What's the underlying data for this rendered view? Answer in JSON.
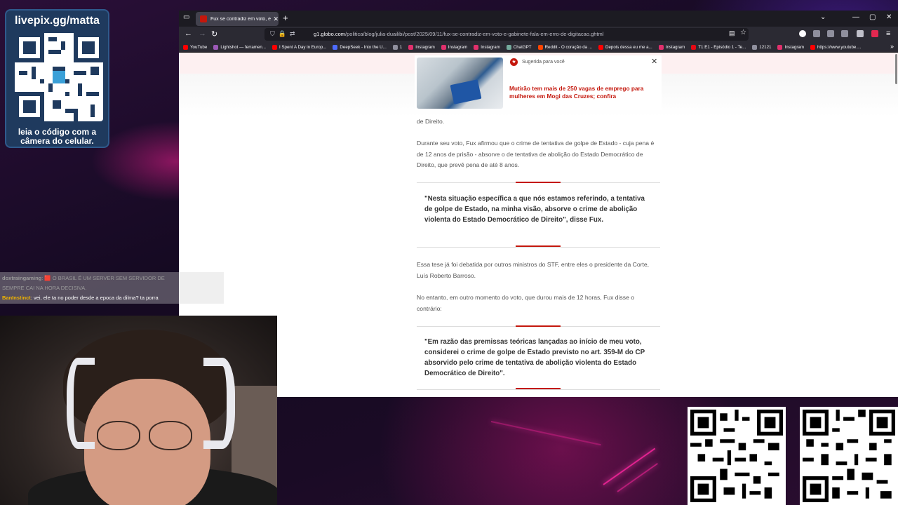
{
  "qr_widget": {
    "title": "livepix.gg/matta",
    "caption_line1": "leia o código com a",
    "caption_line2": "câmera do celular."
  },
  "browser": {
    "tab_title": "Fux se contradiz em voto, e gab",
    "url_host": "g1.globo.com",
    "url_path": "/politica/blog/julia-duailibi/post/2025/09/11/fux-se-contradiz-em-voto-e-gabinete-fala-em-erro-de-digitacao.ghtml",
    "bookmarks": [
      {
        "label": "YouTube",
        "color": "#ff0000"
      },
      {
        "label": "Lightshot — ferramen...",
        "color": "#9b59b6"
      },
      {
        "label": "I Spent A Day in Europ...",
        "color": "#ff0000"
      },
      {
        "label": "DeepSeek - Into the U...",
        "color": "#4d6bfe"
      },
      {
        "label": "1",
        "color": "#8f8f9d"
      },
      {
        "label": "Instagram",
        "color": "#e1306c"
      },
      {
        "label": "Instagram",
        "color": "#e1306c"
      },
      {
        "label": "Instagram",
        "color": "#e1306c"
      },
      {
        "label": "ChatGPT",
        "color": "#74aa9c"
      },
      {
        "label": "Reddit - O coração da ...",
        "color": "#ff4500"
      },
      {
        "label": "Depois dessa eu me a...",
        "color": "#ff0000"
      },
      {
        "label": "Instagram",
        "color": "#e1306c"
      },
      {
        "label": "T1:E1 - Episódio 1 - Te...",
        "color": "#e50914"
      },
      {
        "label": "12121",
        "color": "#8f8f9d"
      },
      {
        "label": "Instagram",
        "color": "#e1306c"
      },
      {
        "label": "https://www.youtube....",
        "color": "#ff0000"
      }
    ]
  },
  "suggestion": {
    "label": "Sugerida para você",
    "title": "Mutirão tem mais de 250 vagas de emprego para mulheres em Mogi das Cruzes; confira"
  },
  "article": {
    "para0": "de Direito.",
    "para1": "Durante seu voto, Fux afirmou que o crime de tentativa de golpe de Estado - cuja pena é de 12 anos de prisão - absorve o de tentativa de abolição do Estado Democrático de Direito, que prevê pena de até 8 anos.",
    "quote1": "\"Nesta situação específica a que nós estamos referindo, a tentativa de golpe de Estado, na minha visão, absorve o crime de abolição violenta do Estado Democrático de Direito\", disse Fux.",
    "para2": "Essa tese já foi debatida por outros ministros do STF, entre eles o presidente da Corte, Luís Roberto Barroso.",
    "para3": "No entanto, em outro momento do voto, que durou mais de 12 horas, Fux disse o contrário:",
    "quote2": "\"Em razão das premissas teóricas lançadas ao início de meu voto, considerei o crime de golpe de Estado previsto no art. 359-M do CP absorvido pelo crime de tentativa de abolição violenta do Estado Democrático de Direito\"."
  },
  "chat": [
    {
      "user": "doxtraingaming",
      "user_color": "#9a9a9a",
      "text": ": 🟥 O BRASIL É UM SERVER SEM SERVIDOR DE ",
      "text_color": "#9a9a9a"
    },
    {
      "user": "",
      "user_color": "#9a9a9a",
      "text": "SEMPRE CAI NA HORA DECISIVA.",
      "text_color": "#9a9a9a"
    },
    {
      "user": "BanInstinct",
      "user_color": "#f0b400",
      "text": ": vei, ele ta no poder desde a epoca da dilma? ta porra",
      "text_color": "#ffffff"
    }
  ],
  "colors": {
    "accent": "#c4170c",
    "browser_chrome": "#2b2a33",
    "neon": "#e0228f"
  }
}
